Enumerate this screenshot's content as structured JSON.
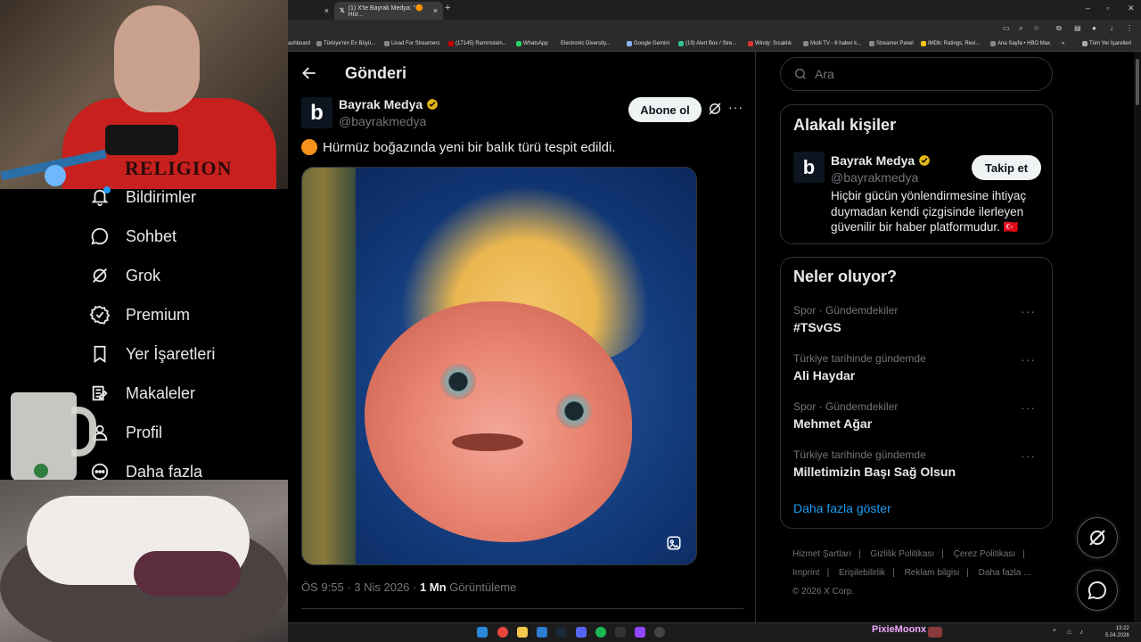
{
  "browser": {
    "tabs": [
      {
        "label": ""
      },
      {
        "label": "(1) X'te Bayrak Medya: \"🟠 Hür..."
      }
    ],
    "bookmarks": [
      "ashboard",
      "Türkiye'nin En Büyü...",
      "Livad For Streamers",
      "(17145) Rammstein...",
      "WhatsApp",
      "Electronic Diversity...",
      "Google Gemini",
      "(19) Alert Box / Stre...",
      "Windy: Sıcaklık",
      "Multi TV - 6 haber k...",
      "Streamer Panel",
      "IMDb: Ratings, Revi...",
      "Ana Sayfa • HBO Max"
    ],
    "bookmarks_overflow": "»",
    "all_bookmarks": "Tüm Yer İşaretleri"
  },
  "nav": {
    "items": [
      {
        "label": "Bildirimler",
        "icon": "bell-icon"
      },
      {
        "label": "Sohbet",
        "icon": "chat-icon"
      },
      {
        "label": "Grok",
        "icon": "grok-icon"
      },
      {
        "label": "Premium",
        "icon": "verified-badge-icon"
      },
      {
        "label": "Yer İşaretleri",
        "icon": "bookmark-icon"
      },
      {
        "label": "Makaleler",
        "icon": "article-icon"
      },
      {
        "label": "Profil",
        "icon": "profile-icon"
      },
      {
        "label": "Daha fazla",
        "icon": "more-circle-icon"
      }
    ]
  },
  "post": {
    "page_title": "Gönderi",
    "author_name": "Bayrak Medya",
    "author_handle": "@bayrakmedya",
    "avatar_letter": "b",
    "subscribe_label": "Abone ol",
    "text": "Hürmüz boğazında yeni bir balık türü tespit edildi.",
    "time": "ÖS 9:55 · 3 Nis 2026 · ",
    "views_count": "1 Mn",
    "views_label": " Görüntüleme"
  },
  "sidebar": {
    "search_placeholder": "Ara",
    "related": {
      "title": "Alakalı kişiler",
      "name": "Bayrak Medya",
      "handle": "@bayrakmedya",
      "follow_label": "Takip et",
      "bio": "Hiçbir gücün yönlendirmesine ihtiyaç duymadan kendi çizgisinde ilerleyen güvenilir bir haber platformudur. 🇹🇷"
    },
    "trends": {
      "title": "Neler oluyor?",
      "items": [
        {
          "category": "Spor · Gündemdekiler",
          "name": "#TSvGS"
        },
        {
          "category": "Türkiye tarihinde gündemde",
          "name": "Ali Haydar"
        },
        {
          "category": "Spor · Gündemdekiler",
          "name": "Mehmet Ağar"
        },
        {
          "category": "Türkiye tarihinde gündemde",
          "name": "Milletimizin Başı Sağ Olsun"
        }
      ],
      "show_more": "Daha fazla göster"
    },
    "footer": {
      "links": [
        "Hizmet Şartları",
        "Gizlilik Politikası",
        "Çerez Politikası",
        "Imprint",
        "Erişilebilirlik",
        "Reklam bilgisi",
        "Daha fazla ..."
      ],
      "copyright": "© 2026 X Corp."
    }
  },
  "overlay": {
    "shirt_text": "RELIGION",
    "stream_name": "PixieMoonx"
  },
  "taskbar": {
    "time": "13:22",
    "date": "5.04.2026"
  },
  "colors": {
    "accent": "#1d9bf0",
    "verified_gold": "#e2b719",
    "bg": "#000000",
    "border": "#2f3336",
    "muted": "#71767b"
  }
}
